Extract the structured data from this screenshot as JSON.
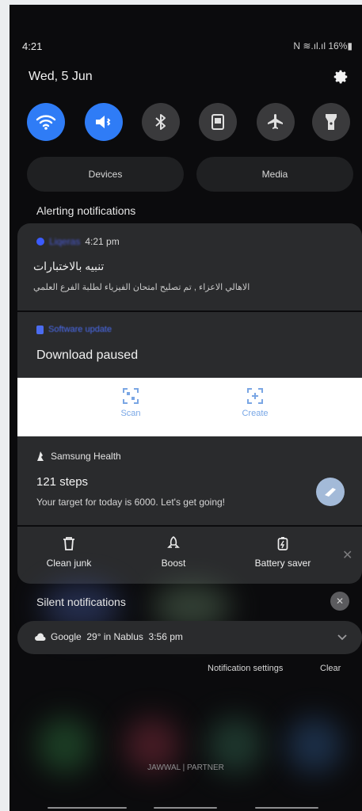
{
  "status_bar": {
    "time": "4:21",
    "indicators": "N  ≋.ıl.ıl 16%▮"
  },
  "header": {
    "date": "Wed, 5 Jun"
  },
  "quick_settings": [
    {
      "name": "wifi-icon",
      "on": true
    },
    {
      "name": "mute-icon",
      "on": true
    },
    {
      "name": "bluetooth-icon",
      "on": false
    },
    {
      "name": "portrait-icon",
      "on": false
    },
    {
      "name": "airplane-icon",
      "on": false
    },
    {
      "name": "flashlight-icon",
      "on": false
    }
  ],
  "media_row": {
    "devices": "Devices",
    "media": "Media"
  },
  "alerting": {
    "title": "Alerting notifications"
  },
  "notif_telegram": {
    "app": "Liqeras",
    "time": "4:21 pm",
    "title": "تنبيه بالاختبارات",
    "body": "الاهالي الاعزاء , تم تصليح امتحان الفيزياء لطلبة الفرع العلمي"
  },
  "notif_update": {
    "app": "Software update",
    "title": "Download paused"
  },
  "scan_band": {
    "scan": "Scan",
    "create": "Create"
  },
  "notif_health": {
    "app": "Samsung Health",
    "title": "121 steps",
    "body": "Your target for today is 6000. Let's get going!"
  },
  "actions": {
    "clean": "Clean junk",
    "boost": "Boost",
    "battery": "Battery saver"
  },
  "silent": {
    "title": "Silent notifications"
  },
  "google": {
    "text": "Google  29° in Nablus  3:56 pm"
  },
  "footer": {
    "settings": "Notification settings",
    "clear": "Clear"
  },
  "carrier": {
    "text": "JAWWAL | PARTNER"
  },
  "colors": {
    "accent": "#2f7cf6",
    "panel": "#2a2b2d",
    "background": "#0b0b0d"
  }
}
